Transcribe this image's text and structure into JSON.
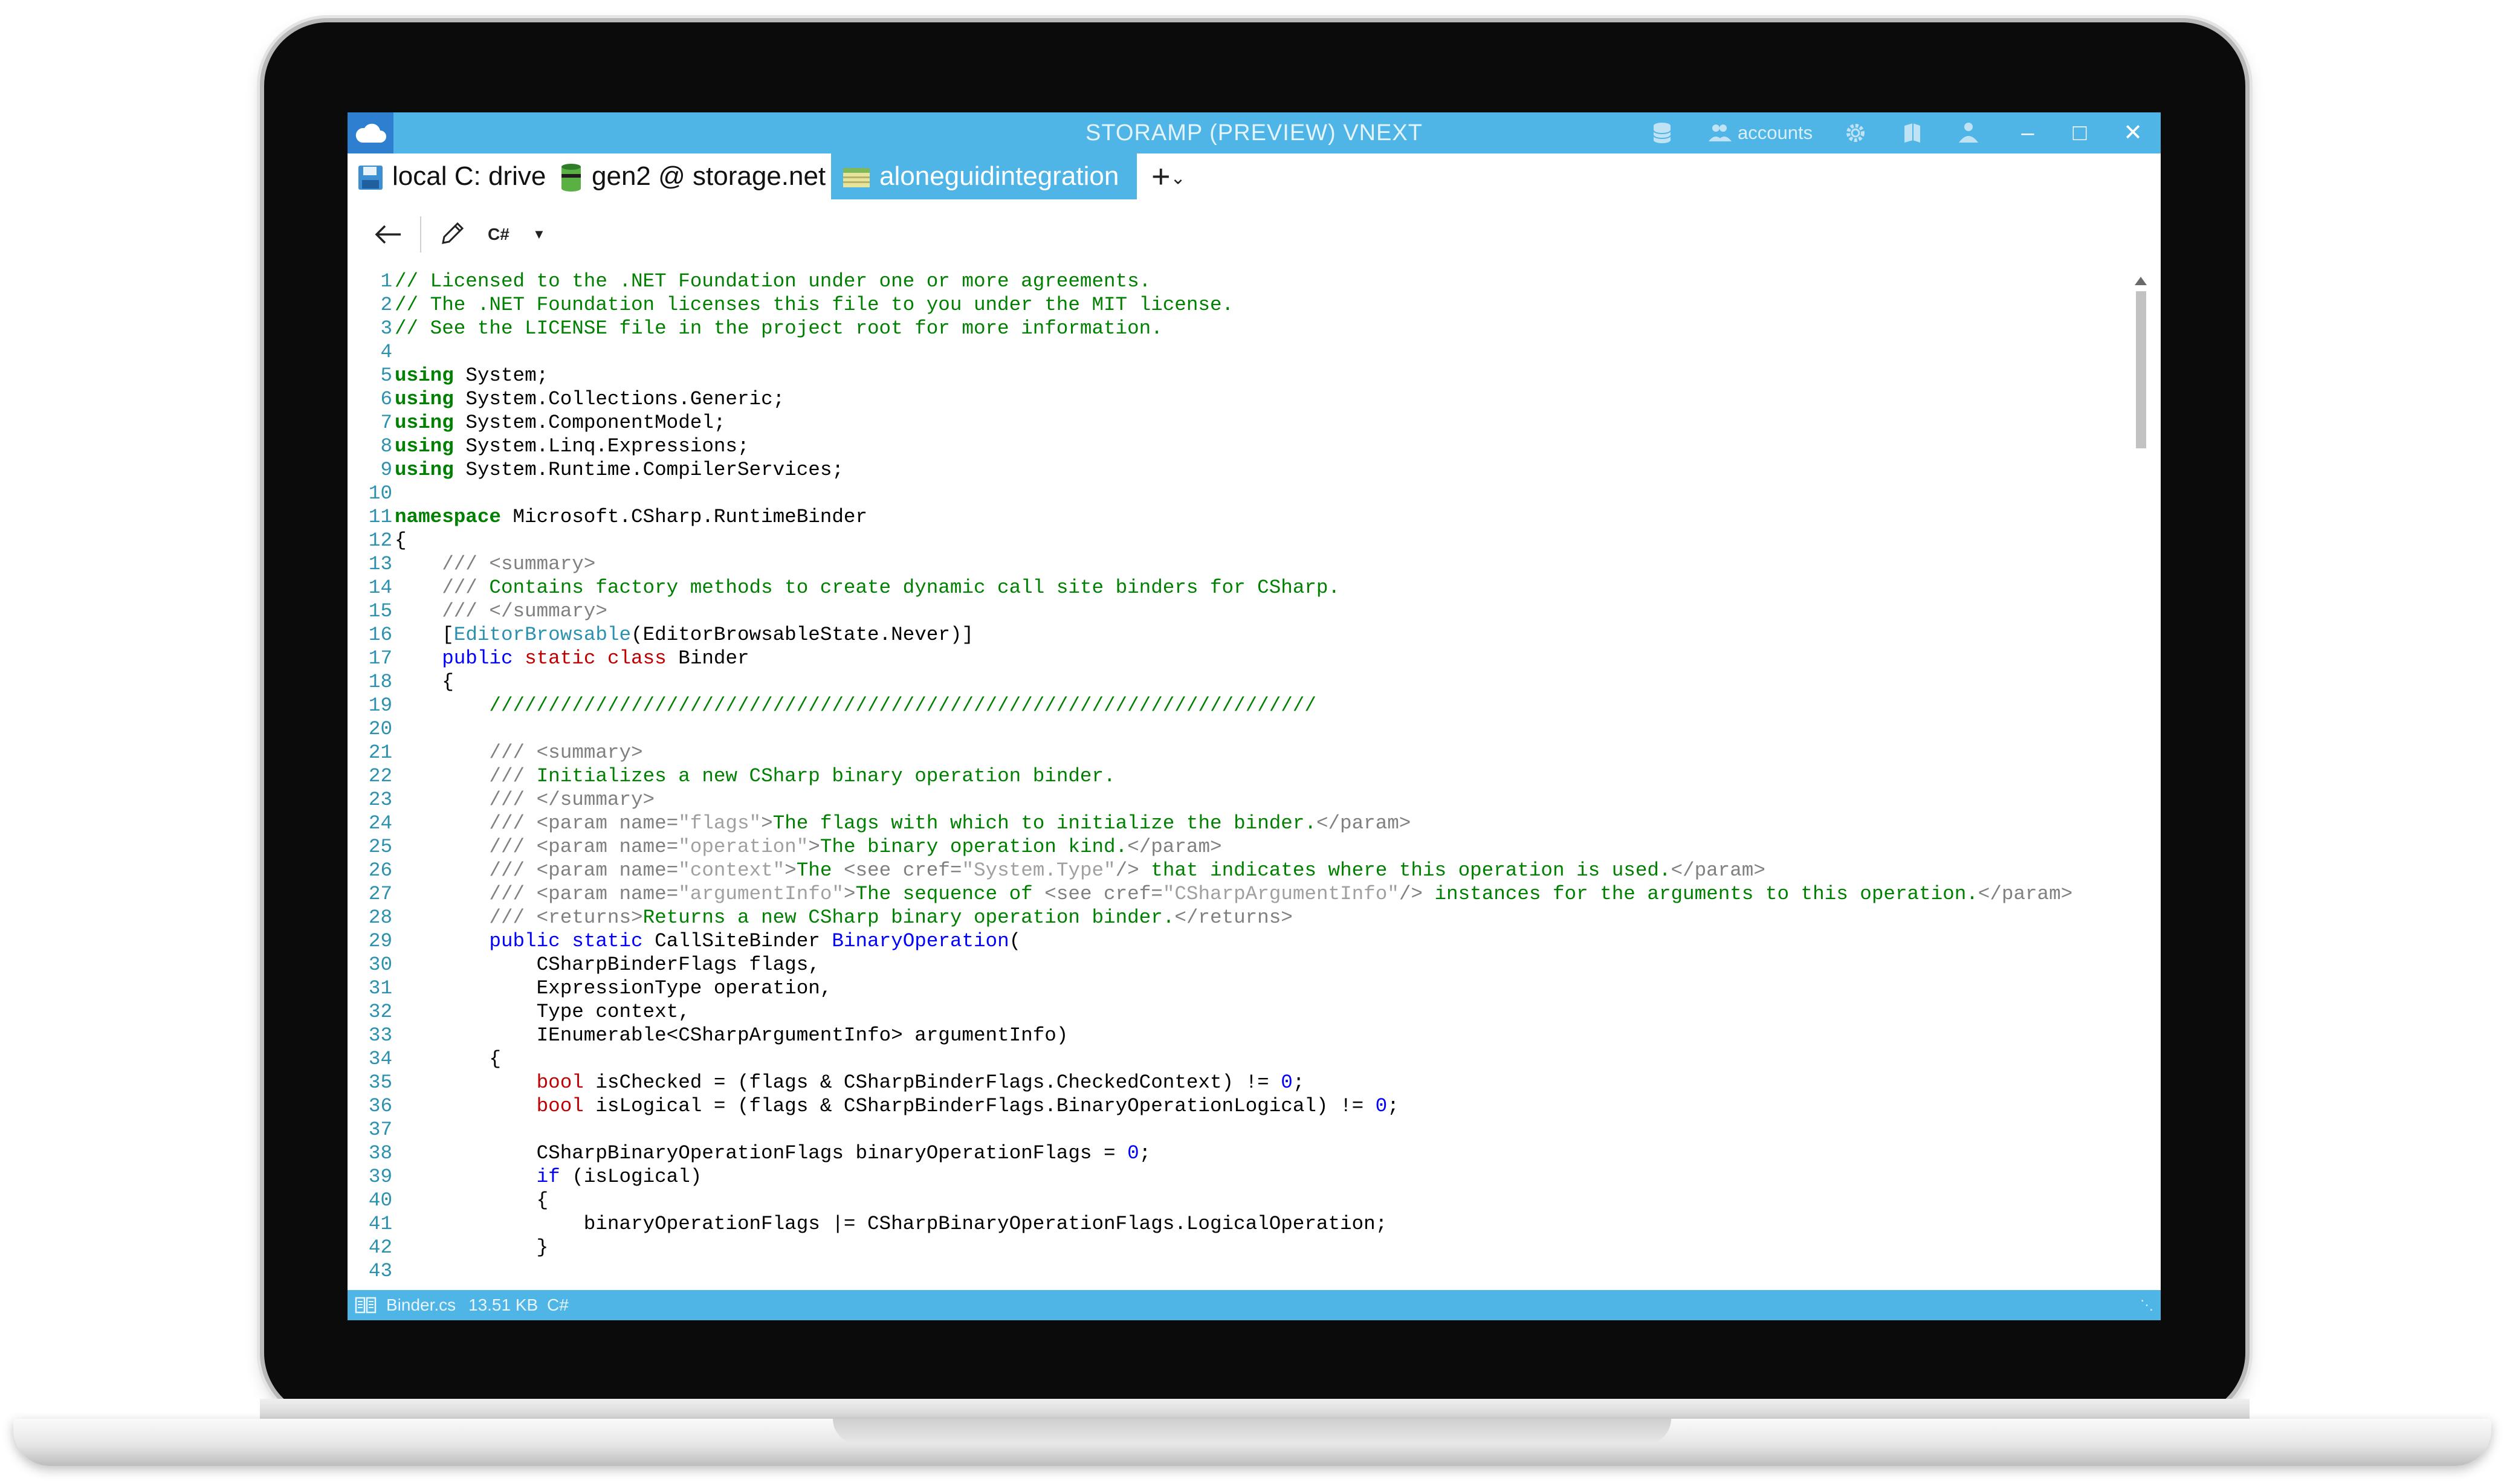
{
  "window": {
    "title": "STORAMP (PREVIEW) VNEXT",
    "accounts_label": "accounts",
    "accent_color": "#4fb4e6",
    "logo_color": "#2e7fcf"
  },
  "tabs": [
    {
      "label": "local C: drive",
      "icon": "floppy-disk-icon",
      "active": false
    },
    {
      "label": "gen2 @ storage.net",
      "icon": "database-icon",
      "active": false
    },
    {
      "label": "aloneguidintegration",
      "icon": "storage-account-icon",
      "active": true
    }
  ],
  "toolbar": {
    "language": "C#"
  },
  "code_lines": [
    {
      "n": "1",
      "html": "<span class='c-comment'>// Licensed to the .NET Foundation under one or more agreements.</span>"
    },
    {
      "n": "2",
      "html": "<span class='c-comment'>// The .NET Foundation licenses this file to you under the MIT license.</span>"
    },
    {
      "n": "3",
      "html": "<span class='c-comment'>// See the LICENSE file in the project root for more information.</span>"
    },
    {
      "n": "4",
      "html": ""
    },
    {
      "n": "5",
      "html": "<span class='c-keyword'>using</span> System;"
    },
    {
      "n": "6",
      "html": "<span class='c-keyword'>using</span> System.Collections.Generic;"
    },
    {
      "n": "7",
      "html": "<span class='c-keyword'>using</span> System.ComponentModel;"
    },
    {
      "n": "8",
      "html": "<span class='c-keyword'>using</span> System.Linq.Expressions;"
    },
    {
      "n": "9",
      "html": "<span class='c-keyword'>using</span> System.Runtime.CompilerServices;"
    },
    {
      "n": "10",
      "html": ""
    },
    {
      "n": "11",
      "html": "<span class='c-keyword'>namespace</span> Microsoft.CSharp.RuntimeBinder"
    },
    {
      "n": "12",
      "html": "{"
    },
    {
      "n": "13",
      "html": "    <span class='c-doc'>/// &lt;summary&gt;</span>"
    },
    {
      "n": "14",
      "html": "    <span class='c-doc'>///</span><span class='c-comment'> Contains factory methods to create dynamic call site binders for CSharp.</span>"
    },
    {
      "n": "15",
      "html": "    <span class='c-doc'>/// &lt;/summary&gt;</span>"
    },
    {
      "n": "16",
      "html": "    [<span class='c-attr'>EditorBrowsable</span>(EditorBrowsableState.Never)]"
    },
    {
      "n": "17",
      "html": "    <span class='c-blue'>public</span> <span class='c-red'>static</span> <span class='c-red'>class</span> Binder"
    },
    {
      "n": "18",
      "html": "    {"
    },
    {
      "n": "19",
      "html": "        <span class='c-comment'>//////////////////////////////////////////////////////////////////////</span>"
    },
    {
      "n": "20",
      "html": ""
    },
    {
      "n": "21",
      "html": "        <span class='c-doc'>/// &lt;summary&gt;</span>"
    },
    {
      "n": "22",
      "html": "        <span class='c-doc'>///</span><span class='c-comment'> Initializes a new CSharp binary operation binder.</span>"
    },
    {
      "n": "23",
      "html": "        <span class='c-doc'>/// &lt;/summary&gt;</span>"
    },
    {
      "n": "24",
      "html": "        <span class='c-doc'>/// &lt;param name=</span><span class='c-str'>\"flags\"</span><span class='c-doc'>&gt;</span><span class='c-comment'>The flags with which to initialize the binder.</span><span class='c-doc'>&lt;/param&gt;</span>"
    },
    {
      "n": "25",
      "html": "        <span class='c-doc'>/// &lt;param name=</span><span class='c-str'>\"operation\"</span><span class='c-doc'>&gt;</span><span class='c-comment'>The binary operation kind.</span><span class='c-doc'>&lt;/param&gt;</span>"
    },
    {
      "n": "26",
      "html": "        <span class='c-doc'>/// &lt;param name=</span><span class='c-str'>\"context\"</span><span class='c-doc'>&gt;</span><span class='c-comment'>The </span><span class='c-doc'>&lt;see cref=</span><span class='c-str'>\"System.Type\"</span><span class='c-doc'>/&gt;</span><span class='c-comment'> that indicates where this operation is used.</span><span class='c-doc'>&lt;/param&gt;</span>"
    },
    {
      "n": "27",
      "html": "        <span class='c-doc'>/// &lt;param name=</span><span class='c-str'>\"argumentInfo\"</span><span class='c-doc'>&gt;</span><span class='c-comment'>The sequence of </span><span class='c-doc'>&lt;see cref=</span><span class='c-str'>\"CSharpArgumentInfo\"</span><span class='c-doc'>/&gt;</span><span class='c-comment'> instances for the arguments to this operation.</span><span class='c-doc'>&lt;/param&gt;</span>"
    },
    {
      "n": "28",
      "html": "        <span class='c-doc'>/// &lt;returns&gt;</span><span class='c-comment'>Returns a new CSharp binary operation binder.</span><span class='c-doc'>&lt;/returns&gt;</span>"
    },
    {
      "n": "29",
      "html": "        <span class='c-blue'>public</span> <span class='c-blue'>static</span> CallSiteBinder <span class='c-blue'>BinaryOperation</span>("
    },
    {
      "n": "30",
      "html": "            CSharpBinderFlags flags,"
    },
    {
      "n": "31",
      "html": "            ExpressionType operation,"
    },
    {
      "n": "32",
      "html": "            Type context,"
    },
    {
      "n": "33",
      "html": "            IEnumerable&lt;CSharpArgumentInfo&gt; argumentInfo)"
    },
    {
      "n": "34",
      "html": "        {"
    },
    {
      "n": "35",
      "html": "            <span class='c-red'>bool</span> isChecked = (flags &amp; CSharpBinderFlags.CheckedContext) != <span class='c-blue'>0</span>;"
    },
    {
      "n": "36",
      "html": "            <span class='c-red'>bool</span> isLogical = (flags &amp; CSharpBinderFlags.BinaryOperationLogical) != <span class='c-blue'>0</span>;"
    },
    {
      "n": "37",
      "html": ""
    },
    {
      "n": "38",
      "html": "            CSharpBinaryOperationFlags binaryOperationFlags = <span class='c-blue'>0</span>;"
    },
    {
      "n": "39",
      "html": "            <span class='c-blue'>if</span> (isLogical)"
    },
    {
      "n": "40",
      "html": "            {"
    },
    {
      "n": "41",
      "html": "                binaryOperationFlags |= CSharpBinaryOperationFlags.LogicalOperation;"
    },
    {
      "n": "42",
      "html": "            }"
    },
    {
      "n": "43",
      "html": ""
    }
  ],
  "status": {
    "file_name": "Binder.cs",
    "file_size": "13.51 KB",
    "language": "C#"
  }
}
